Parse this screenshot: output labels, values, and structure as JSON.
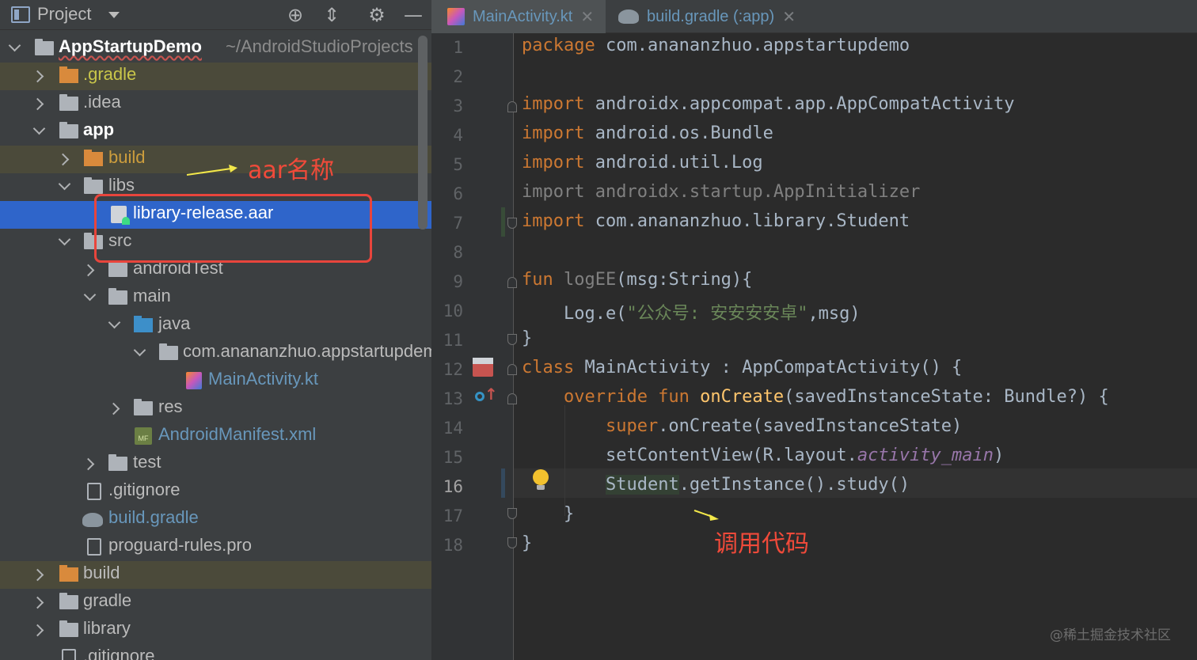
{
  "project_panel": {
    "title": "Project",
    "toolbar_icons": [
      "crosshair-icon",
      "collapse-all-icon",
      "gear-icon",
      "minimize-icon"
    ],
    "tree": [
      {
        "label": "AppStartupDemo",
        "path": "~/AndroidStudioProjects",
        "icon": "module-folder-icon",
        "expanded": true
      },
      {
        "label": ".gradle",
        "icon": "folder-icon",
        "excluded": true
      },
      {
        "label": ".idea",
        "icon": "folder-icon"
      },
      {
        "label": "app",
        "icon": "module-folder-icon",
        "expanded": true
      },
      {
        "label": "build",
        "icon": "folder-icon",
        "excluded": true
      },
      {
        "label": "libs",
        "icon": "folder-icon",
        "expanded": true
      },
      {
        "label": "library-release.aar",
        "icon": "aar-file-icon",
        "selected": true
      },
      {
        "label": "src",
        "icon": "folder-icon",
        "expanded": true
      },
      {
        "label": "androidTest",
        "icon": "folder-icon"
      },
      {
        "label": "main",
        "icon": "folder-icon",
        "expanded": true
      },
      {
        "label": "java",
        "icon": "source-folder-icon",
        "expanded": true
      },
      {
        "label": "com.anananzhuo.appstartupdemo",
        "icon": "package-icon",
        "expanded": true
      },
      {
        "label": "MainActivity.kt",
        "icon": "kotlin-file-icon"
      },
      {
        "label": "res",
        "icon": "resource-folder-icon"
      },
      {
        "label": "AndroidManifest.xml",
        "icon": "manifest-file-icon"
      },
      {
        "label": "test",
        "icon": "folder-icon"
      },
      {
        "label": ".gitignore",
        "icon": "gitignore-file-icon"
      },
      {
        "label": "build.gradle",
        "icon": "gradle-file-icon"
      },
      {
        "label": "proguard-rules.pro",
        "icon": "text-file-icon"
      },
      {
        "label": "build",
        "icon": "folder-icon",
        "excluded": true
      },
      {
        "label": "gradle",
        "icon": "folder-icon"
      },
      {
        "label": "library",
        "icon": "module-folder-icon"
      },
      {
        "label": ".gitignore",
        "icon": "gitignore-file-icon"
      }
    ]
  },
  "editor": {
    "tabs": [
      {
        "label": "MainActivity.kt",
        "icon": "kotlin-file-icon",
        "active": true
      },
      {
        "label": "build.gradle (:app)",
        "icon": "gradle-file-icon",
        "active": false
      }
    ],
    "current_line": 16,
    "line_numbers": [
      "1",
      "2",
      "3",
      "4",
      "5",
      "6",
      "7",
      "8",
      "9",
      "10",
      "11",
      "12",
      "13",
      "14",
      "15",
      "16",
      "17",
      "18"
    ],
    "code": {
      "l1": {
        "kw": "package",
        "rest": " com.anananzhuo.appstartupdemo"
      },
      "l3": {
        "kw": "import",
        "rest": " androidx.appcompat.app.AppCompatActivity"
      },
      "l4": {
        "kw": "import",
        "rest": " android.os.Bundle"
      },
      "l5": {
        "kw": "import",
        "rest": " android.util.Log"
      },
      "l6": {
        "text": "import androidx.startup.AppInitializer"
      },
      "l7": {
        "kw": "import",
        "rest": " com.anananzhuo.library.Student"
      },
      "l9": {
        "kw": "fun",
        "name": " logEE",
        "rest": "(msg:String){"
      },
      "l10": {
        "pre": "    Log.e(",
        "str": "\"公众号: 安安安安卓\"",
        "post": ",msg)"
      },
      "l11": {
        "text": "}"
      },
      "l12": {
        "kw": "class",
        "rest": " MainActivity : AppCompatActivity() {"
      },
      "l13": {
        "kw": "    override fun ",
        "fn": "onCreate",
        "rest": "(savedInstanceState: Bundle?) {"
      },
      "l14": {
        "kw": "        super",
        "rest": ".onCreate(savedInstanceState)"
      },
      "l15": {
        "pre": "        setContentView(R.layout.",
        "prop": "activity_main",
        "post": ")"
      },
      "l16": {
        "pre": "        ",
        "cls": "Student",
        "post": ".getInstance().study()"
      },
      "l17": {
        "text": "    }"
      },
      "l18": {
        "text": "}"
      }
    },
    "gutter_icons": [
      "implementation-icon",
      "override-icon",
      "lightbulb-icon"
    ]
  },
  "annotations": {
    "aar_label": "aar名称",
    "call_label": "调用代码",
    "color": "#f04a3a"
  },
  "watermark": "@稀土掘金技术社区",
  "colors": {
    "selection": "#2f65ca",
    "keyword": "#cc7832",
    "string": "#6a8759",
    "function": "#ffc66d"
  }
}
